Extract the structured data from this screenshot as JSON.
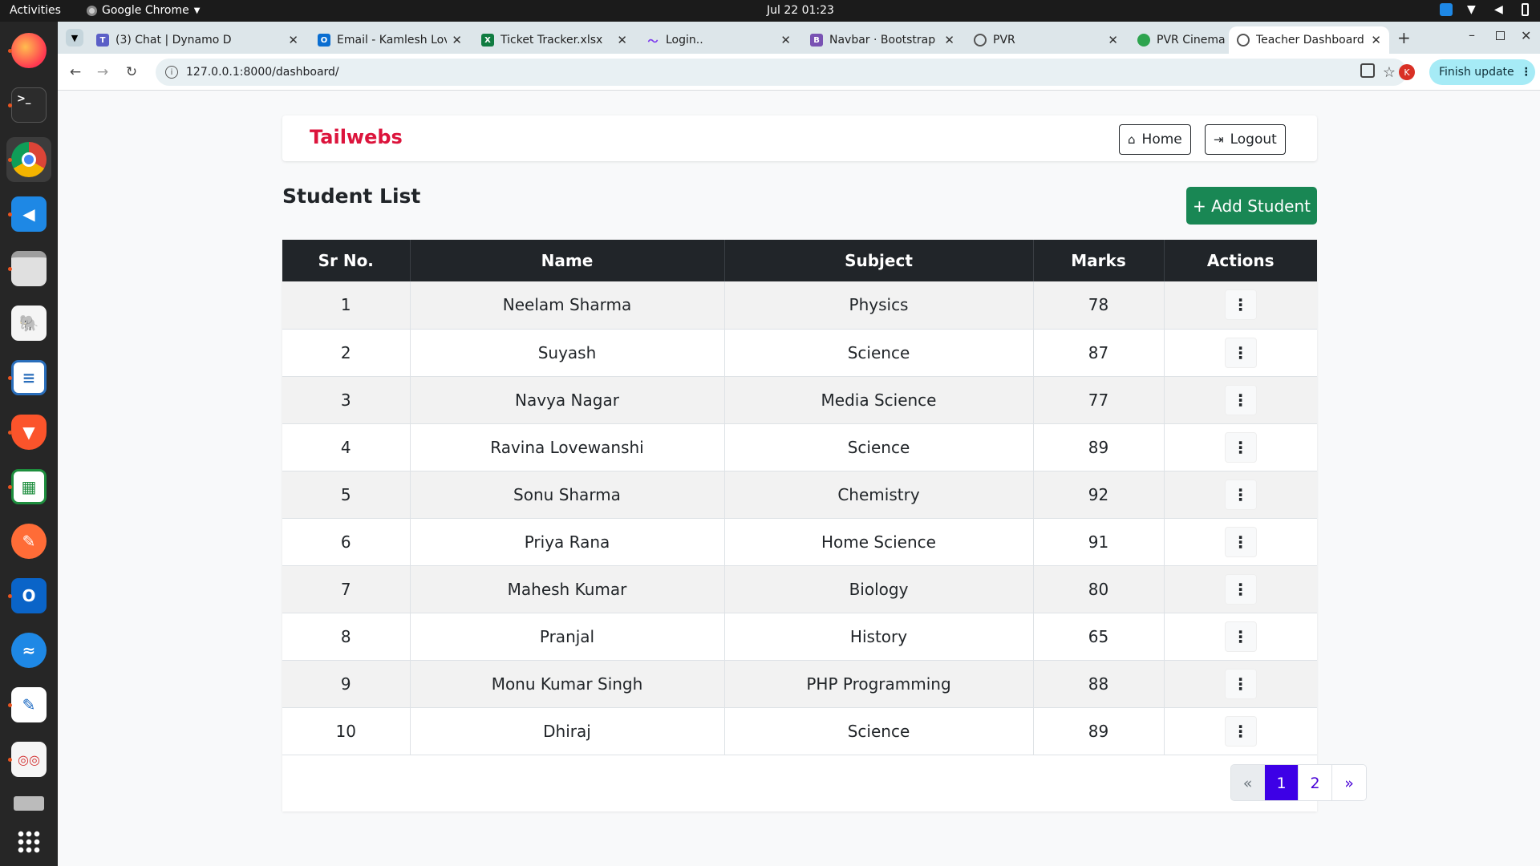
{
  "topbar": {
    "activities": "Activities",
    "app_name": "Google Chrome",
    "clock": "Jul 22  01:23"
  },
  "dock": {
    "items": [
      "firefox-icon",
      "terminal-icon",
      "chrome-icon",
      "vscode-icon",
      "files-icon",
      "pgadmin-icon",
      "writer-icon",
      "brave-icon",
      "calc-icon",
      "postman-icon",
      "outlook-icon",
      "zoho-icon",
      "text-editor-icon",
      "document-viewer-icon",
      "usb-drive-icon",
      "app-grid-icon"
    ]
  },
  "tabs": [
    {
      "title": "(3) Chat | Dynamo D",
      "color": "#5b5fc7"
    },
    {
      "title": "Email - Kamlesh Lov",
      "color": "#0a6ed1"
    },
    {
      "title": "Ticket Tracker.xlsx",
      "color": "#107c41"
    },
    {
      "title": "Login..",
      "color": "#7c3aed"
    },
    {
      "title": "Navbar · Bootstrap",
      "color": "#7952b3"
    },
    {
      "title": "PVR",
      "color": "#555555"
    },
    {
      "title": "PVR Cinema API",
      "color": "#2ea44f"
    },
    {
      "title": "Teacher Dashboard",
      "color": "#555555"
    }
  ],
  "browser": {
    "url": "127.0.0.1:8000/dashboard/",
    "profile_initial": "K",
    "finish_update": "Finish update"
  },
  "navbar": {
    "brand": "Tailwebs",
    "home": "Home",
    "logout": "Logout"
  },
  "page": {
    "title": "Student List",
    "add_button": "+ Add Student"
  },
  "table": {
    "headers": [
      "Sr No.",
      "Name",
      "Subject",
      "Marks",
      "Actions"
    ],
    "rows": [
      {
        "sr": "1",
        "name": "Neelam Sharma",
        "subject": "Physics",
        "marks": "78"
      },
      {
        "sr": "2",
        "name": "Suyash",
        "subject": "Science",
        "marks": "87"
      },
      {
        "sr": "3",
        "name": "Navya Nagar",
        "subject": "Media Science",
        "marks": "77"
      },
      {
        "sr": "4",
        "name": "Ravina Lovewanshi",
        "subject": "Science",
        "marks": "89"
      },
      {
        "sr": "5",
        "name": "Sonu Sharma",
        "subject": "Chemistry",
        "marks": "92"
      },
      {
        "sr": "6",
        "name": "Priya Rana",
        "subject": "Home Science",
        "marks": "91"
      },
      {
        "sr": "7",
        "name": "Mahesh Kumar",
        "subject": "Biology",
        "marks": "80"
      },
      {
        "sr": "8",
        "name": "Pranjal",
        "subject": "History",
        "marks": "65"
      },
      {
        "sr": "9",
        "name": "Monu Kumar Singh",
        "subject": "PHP Programming",
        "marks": "88"
      },
      {
        "sr": "10",
        "name": "Dhiraj",
        "subject": "Science",
        "marks": "89"
      }
    ]
  },
  "pagination": {
    "prev": "«",
    "pages": [
      "1",
      "2"
    ],
    "next": "»",
    "active_page": "1"
  },
  "colors": {
    "brand": "#dc143c",
    "add_button": "#198754",
    "table_header": "#212529",
    "page_active": "#3d00e6"
  }
}
